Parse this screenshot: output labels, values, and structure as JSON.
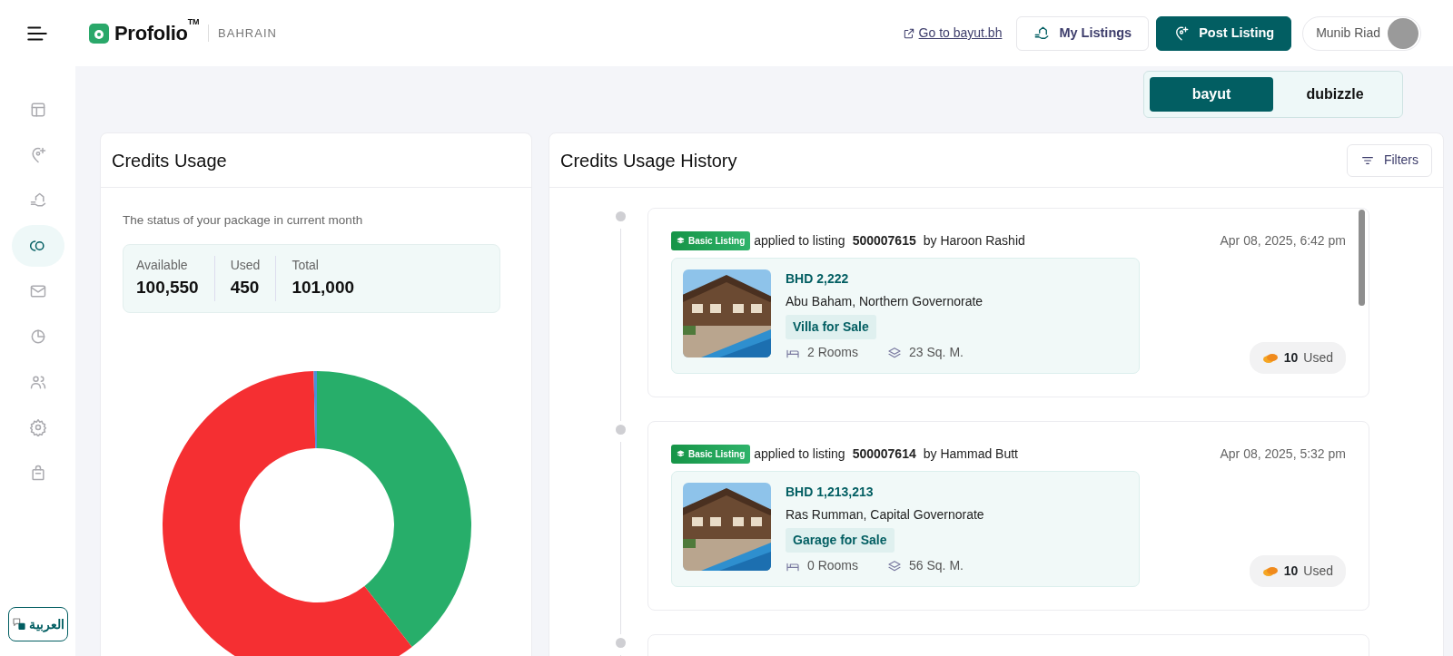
{
  "header": {
    "brand": "Profolio",
    "trademark": "TM",
    "region": "BAHRAIN",
    "external_link": "Go to bayut.bh",
    "buttons": [
      {
        "label": "My Listings",
        "kind": "outline"
      },
      {
        "label": "Post Listing",
        "kind": "primary"
      }
    ],
    "user": {
      "name": "Munib Riad"
    }
  },
  "sidebar": {
    "items": [
      {
        "selected": false
      },
      {
        "selected": false
      },
      {
        "selected": false
      },
      {
        "selected": true
      },
      {
        "selected": false
      },
      {
        "selected": false
      },
      {
        "selected": false
      },
      {
        "selected": false
      },
      {
        "selected": false
      }
    ],
    "language": "العربية"
  },
  "platforms": [
    {
      "label": "bayut",
      "selected": true
    },
    {
      "label": "dubizzle",
      "selected": false
    }
  ],
  "credits_usage": {
    "title": "Credits Usage",
    "subtitle": "The status of your package in current month",
    "stats": [
      {
        "label": "Available",
        "value": "100,550"
      },
      {
        "label": "Used",
        "value": "450"
      },
      {
        "label": "Total",
        "value": "101,000"
      }
    ]
  },
  "history": {
    "title": "Credits Usage History",
    "filter_button": "Filters",
    "entries": [
      {
        "badge": "Basic Listing",
        "action": "applied to listing",
        "listing_id": "500007615",
        "by": "by Haroon Rashid",
        "time": "Apr 08, 2025, 6:42 pm",
        "price": "BHD 2,222",
        "location": "Abu Baham, Northern Governorate",
        "type": "Villa for Sale",
        "rooms": "2 Rooms",
        "area": "23 Sq. M.",
        "credits": "10",
        "credits_label": "Used"
      },
      {
        "badge": "Basic Listing",
        "action": "applied to listing",
        "listing_id": "500007614",
        "by": "by Hammad Butt",
        "time": "Apr 08, 2025, 5:32 pm",
        "price": "BHD 1,213,213",
        "location": "Ras Rumman, Capital Governorate",
        "type": "Garage for Sale",
        "rooms": "0 Rooms",
        "area": "56 Sq. M.",
        "credits": "10",
        "credits_label": "Used"
      }
    ]
  }
}
